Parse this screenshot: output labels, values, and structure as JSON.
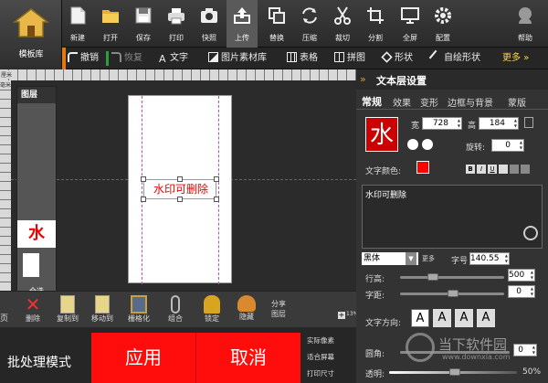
{
  "toolbar": {
    "logo_label": "模板库",
    "items": [
      {
        "label": "新建",
        "icon": "new-file-icon"
      },
      {
        "label": "打开",
        "icon": "folder-icon"
      },
      {
        "label": "保存",
        "icon": "save-icon"
      },
      {
        "label": "打印",
        "icon": "printer-icon"
      },
      {
        "label": "快照",
        "icon": "camera-icon"
      },
      {
        "label": "上传",
        "icon": "upload-icon"
      },
      {
        "label": "替换",
        "icon": "copy-icon"
      },
      {
        "label": "压缩",
        "icon": "refresh-icon"
      },
      {
        "label": "裁切",
        "icon": "scissors-icon"
      },
      {
        "label": "分割",
        "icon": "crop-icon"
      },
      {
        "label": "全屏",
        "icon": "monitor-icon"
      },
      {
        "label": "配置",
        "icon": "gear-icon"
      },
      {
        "label": "帮助",
        "icon": "help-icon"
      }
    ]
  },
  "toolbar2": {
    "undo": "撤销",
    "redo": "恢复",
    "text": "文字",
    "material": "图片素材库",
    "table": "表格",
    "collage": "拼图",
    "shape": "形状",
    "custom_shape": "自绘形状",
    "more": "更多"
  },
  "ruler": {
    "h_unit": "厘米",
    "v_unit": "毫米"
  },
  "layers": {
    "title": "图层",
    "thumb_char": "水",
    "select_all": "全选",
    "zoom": "13%"
  },
  "canvas": {
    "watermark_text": "水印可删除"
  },
  "bottom_tools": [
    {
      "label": "删除",
      "icon": "delete-icon"
    },
    {
      "label": "复制到",
      "icon": "copy-to-icon"
    },
    {
      "label": "移动到",
      "icon": "move-to-icon"
    },
    {
      "label": "栅格化",
      "icon": "rasterize-icon"
    },
    {
      "label": "组合",
      "icon": "paperclip-icon"
    },
    {
      "label": "锁定",
      "icon": "lock-icon"
    },
    {
      "label": "隐藏",
      "icon": "hide-icon"
    }
  ],
  "bottom_extra": {
    "share": "分享",
    "layer": "图层",
    "left_cut": "页",
    "left_cut2": "置"
  },
  "batch": {
    "label": "批处理模式",
    "apply": "应用",
    "cancel": "取消"
  },
  "view_options": [
    "实际像素",
    "适合屏幕",
    "打印尺寸"
  ],
  "panel": {
    "title": "文本层设置",
    "tabs": [
      "常规",
      "效果",
      "变形",
      "边框与背景",
      "蒙版"
    ],
    "preview_char": "水",
    "width_label": "宽",
    "width": "728",
    "height_label": "高",
    "height": "184",
    "rotate_label": "旋转:",
    "rotate": "0",
    "color_label": "文字颜色:",
    "color": "#ff0000",
    "text_content": "水印可删除",
    "font": "黑体",
    "more": "更多",
    "size_label": "字号",
    "size": "140.55",
    "line_height_label": "行高:",
    "line_height": "500",
    "spacing_label": "字距:",
    "spacing": "0",
    "direction_label": "文字方向:",
    "corner_label": "圆角:",
    "corner": "0",
    "opacity_label": "透明:",
    "opacity": "50%"
  },
  "watermark": {
    "site_name": "当下软件园",
    "site_url": "www.downxia.com"
  }
}
